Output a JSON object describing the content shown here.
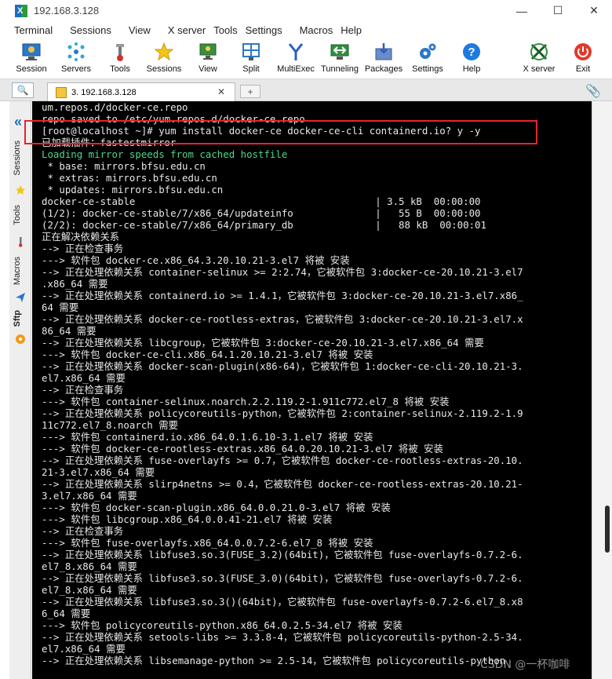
{
  "window": {
    "title": "192.168.3.128",
    "minimize": "—",
    "maximize": "☐",
    "close": "✕"
  },
  "menu": [
    "Terminal",
    "Sessions",
    "View",
    "X server",
    "Tools",
    "Settings",
    "Macros",
    "Help"
  ],
  "toolbar": {
    "session": "Session",
    "servers": "Servers",
    "tools": "Tools",
    "sessions": "Sessions",
    "view": "View",
    "split": "Split",
    "multiexec": "MultiExec",
    "tunneling": "Tunneling",
    "packages": "Packages",
    "settings": "Settings",
    "help": "Help",
    "xserver": "X server",
    "exit": "Exit"
  },
  "tabs": {
    "active_label": "3. 192.168.3.128",
    "close": "✕",
    "new_tab": "+"
  },
  "side": {
    "sessions": "Sessions",
    "tools": "Tools",
    "macros": "Macros",
    "sftp": "Sftp"
  },
  "terminal": {
    "lines": [
      "um.repos.d/docker-ce.repo",
      "repo saved to /etc/yum.repos.d/docker-ce.repo",
      "[root@localhost ~]# yum install docker-ce docker-ce-cli containerd.io? y -y",
      "已加载插件：fastestmirror",
      "Loading mirror speeds from cached hostfile",
      " * base: mirrors.bfsu.edu.cn",
      " * extras: mirrors.bfsu.edu.cn",
      " * updates: mirrors.bfsu.edu.cn",
      "docker-ce-stable                                         | 3.5 kB  00:00:00",
      "(1/2): docker-ce-stable/7/x86_64/updateinfo              |   55 B  00:00:00",
      "(2/2): docker-ce-stable/7/x86_64/primary_db              |   88 kB  00:00:01",
      "正在解决依赖关系",
      "--> 正在检查事务",
      "---> 软件包 docker-ce.x86_64.3.20.10.21-3.el7 将被 安装",
      "--> 正在处理依赖关系 container-selinux >= 2:2.74，它被软件包 3:docker-ce-20.10.21-3.el7",
      ".x86_64 需要",
      "--> 正在处理依赖关系 containerd.io >= 1.4.1，它被软件包 3:docker-ce-20.10.21-3.el7.x86_",
      "64 需要",
      "--> 正在处理依赖关系 docker-ce-rootless-extras，它被软件包 3:docker-ce-20.10.21-3.el7.x",
      "86_64 需要",
      "--> 正在处理依赖关系 libcgroup，它被软件包 3:docker-ce-20.10.21-3.el7.x86_64 需要",
      "---> 软件包 docker-ce-cli.x86_64.1.20.10.21-3.el7 将被 安装",
      "--> 正在处理依赖关系 docker-scan-plugin(x86-64)，它被软件包 1:docker-ce-cli-20.10.21-3.",
      "el7.x86_64 需要",
      "--> 正在检查事务",
      "---> 软件包 container-selinux.noarch.2.2.119.2-1.911c772.el7_8 将被 安装",
      "--> 正在处理依赖关系 policycoreutils-python，它被软件包 2:container-selinux-2.119.2-1.9",
      "11c772.el7_8.noarch 需要",
      "---> 软件包 containerd.io.x86_64.0.1.6.10-3.1.el7 将被 安装",
      "---> 软件包 docker-ce-rootless-extras.x86_64.0.20.10.21-3.el7 将被 安装",
      "--> 正在处理依赖关系 fuse-overlayfs >= 0.7，它被软件包 docker-ce-rootless-extras-20.10.",
      "21-3.el7.x86_64 需要",
      "--> 正在处理依赖关系 slirp4netns >= 0.4，它被软件包 docker-ce-rootless-extras-20.10.21-",
      "3.el7.x86_64 需要",
      "---> 软件包 docker-scan-plugin.x86_64.0.0.21.0-3.el7 将被 安装",
      "---> 软件包 libcgroup.x86_64.0.0.41-21.el7 将被 安装",
      "--> 正在检查事务",
      "---> 软件包 fuse-overlayfs.x86_64.0.0.7.2-6.el7_8 将被 安装",
      "--> 正在处理依赖关系 libfuse3.so.3(FUSE_3.2)(64bit)，它被软件包 fuse-overlayfs-0.7.2-6.",
      "el7_8.x86_64 需要",
      "--> 正在处理依赖关系 libfuse3.so.3(FUSE_3.0)(64bit)，它被软件包 fuse-overlayfs-0.7.2-6.",
      "el7_8.x86_64 需要",
      "--> 正在处理依赖关系 libfuse3.so.3()(64bit)，它被软件包 fuse-overlayfs-0.7.2-6.el7_8.x8",
      "6_64 需要",
      "---> 软件包 policycoreutils-python.x86_64.0.2.5-34.el7 将被 安装",
      "--> 正在处理依赖关系 setools-libs >= 3.3.8-4，它被软件包 policycoreutils-python-2.5-34.",
      "el7.x86_64 需要",
      "--> 正在处理依赖关系 libsemanage-python >= 2.5-14，它被软件包 policycoreutils-python"
    ]
  },
  "watermark": "CSDN @一杯咖啡",
  "colors": {
    "accent": "#1b6dc2",
    "highlight": "#e8232d",
    "terminal_bg": "#000000",
    "terminal_fg": "#e8e8e8",
    "terminal_green": "#4fd78a"
  }
}
